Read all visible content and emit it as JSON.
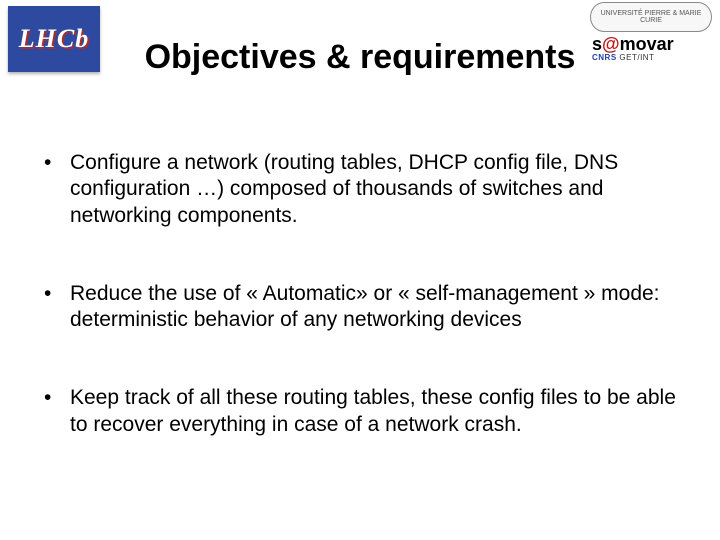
{
  "logos": {
    "left_text": "LHCb",
    "right_top_text": "UNIVERSITÉ PIERRE & MARIE CURIE",
    "right_brand_prefix": "s",
    "right_brand_at": "@",
    "right_brand_suffix": "movar",
    "right_sub_cnrs": "CNRS",
    "right_sub_rest": "   GET/INT"
  },
  "title": "Objectives & requirements",
  "bullets": [
    "Configure a network (routing tables, DHCP config file, DNS configuration …) composed of thousands of switches and networking components.",
    "Reduce the use of « Automatic» or «  self-management » mode: deterministic behavior of any networking devices",
    "Keep track of all these routing tables, these config files to be able to recover everything in case of a network crash."
  ]
}
